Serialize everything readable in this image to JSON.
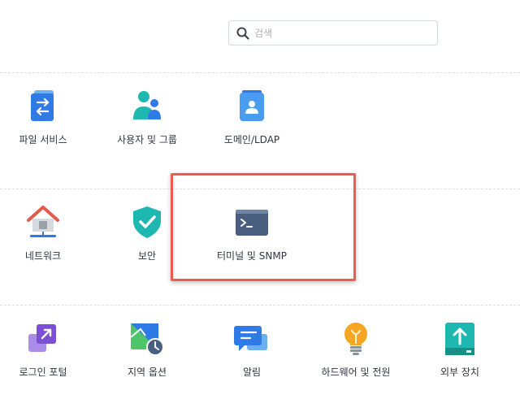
{
  "search": {
    "placeholder": "검색"
  },
  "sections": [
    {
      "items": [
        {
          "label": "파일 서비스",
          "icon": "file-services-icon"
        },
        {
          "label": "사용자 및 그룹",
          "icon": "users-groups-icon"
        },
        {
          "label": "도메인/LDAP",
          "icon": "domain-ldap-icon"
        }
      ]
    },
    {
      "items": [
        {
          "label": "네트워크",
          "icon": "network-icon"
        },
        {
          "label": "보안",
          "icon": "security-shield-icon"
        },
        {
          "label": "터미널 및 SNMP",
          "icon": "terminal-icon",
          "highlighted": true
        }
      ]
    },
    {
      "items": [
        {
          "label": "로그인 포털",
          "icon": "login-portal-icon"
        },
        {
          "label": "지역 옵션",
          "icon": "regional-options-icon"
        },
        {
          "label": "알림",
          "icon": "notification-icon"
        },
        {
          "label": "하드웨어 및 전원",
          "icon": "hardware-power-icon"
        },
        {
          "label": "외부 장치",
          "icon": "external-devices-icon"
        }
      ]
    }
  ],
  "colors": {
    "highlight": "#ef5a50",
    "accent": "#2f80ed"
  }
}
